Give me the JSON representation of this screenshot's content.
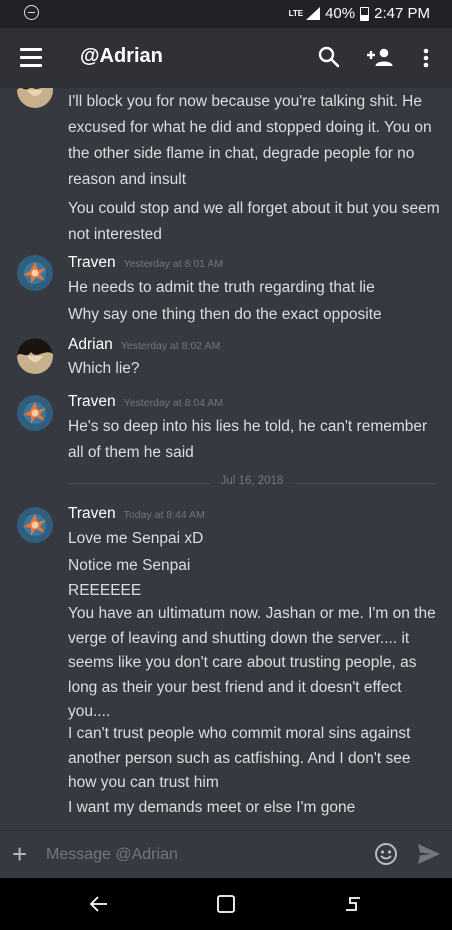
{
  "status_bar": {
    "network": "LTE",
    "battery": "40%",
    "time": "2:47 PM"
  },
  "header": {
    "title": "@Adrian"
  },
  "messages": {
    "adrian_1": {
      "lines": [
        "I'll block you for now because you're talking shit. He excused for what he did and stopped doing it. You on the other side flame in chat, degrade people for no reason and insult",
        "You could stop and we all forget about it but you seem not interested"
      ]
    },
    "traven_1": {
      "username": "Traven",
      "timestamp": "Yesterday at 8:01 AM",
      "lines": [
        "He needs to admit the truth regarding that lie",
        "Why say one thing then do the exact opposite"
      ]
    },
    "adrian_2": {
      "username": "Adrian",
      "timestamp": "Yesterday at 8:02 AM",
      "lines": [
        "Which lie?"
      ]
    },
    "traven_2": {
      "username": "Traven",
      "timestamp": "Yesterday at 8:04 AM",
      "lines": [
        "He's so deep into his lies he told, he can't remember all of them he said"
      ]
    },
    "date_divider": "Jul 16, 2018",
    "traven_3": {
      "username": "Traven",
      "timestamp": "Today at 8:44 AM",
      "lines": [
        "Love me Senpai xD",
        "Notice me Senpai",
        "REEEEEE",
        "You have an ultimatum now. Jashan or me. I'm on the verge of leaving and shutting down the server.... it seems like you don't care about trusting people, as long as their your best friend and it doesn't effect you....",
        "I can't trust people who commit moral sins against another person such as catfishing. And I don't see how you can trust him",
        "I want my demands meet or else I'm gone"
      ]
    }
  },
  "composer": {
    "placeholder": "Message @Adrian"
  },
  "colors": {
    "background": "#36393f",
    "header": "#2f3136",
    "text": "#dcddde",
    "muted": "#72767d"
  },
  "icons": [
    "dnd-icon",
    "signal-icon",
    "battery-icon",
    "menu-icon",
    "search-icon",
    "add-friend-icon",
    "more-vert-icon",
    "plus-icon",
    "emoji-icon",
    "send-icon",
    "back-icon",
    "home-icon",
    "recents-icon"
  ]
}
